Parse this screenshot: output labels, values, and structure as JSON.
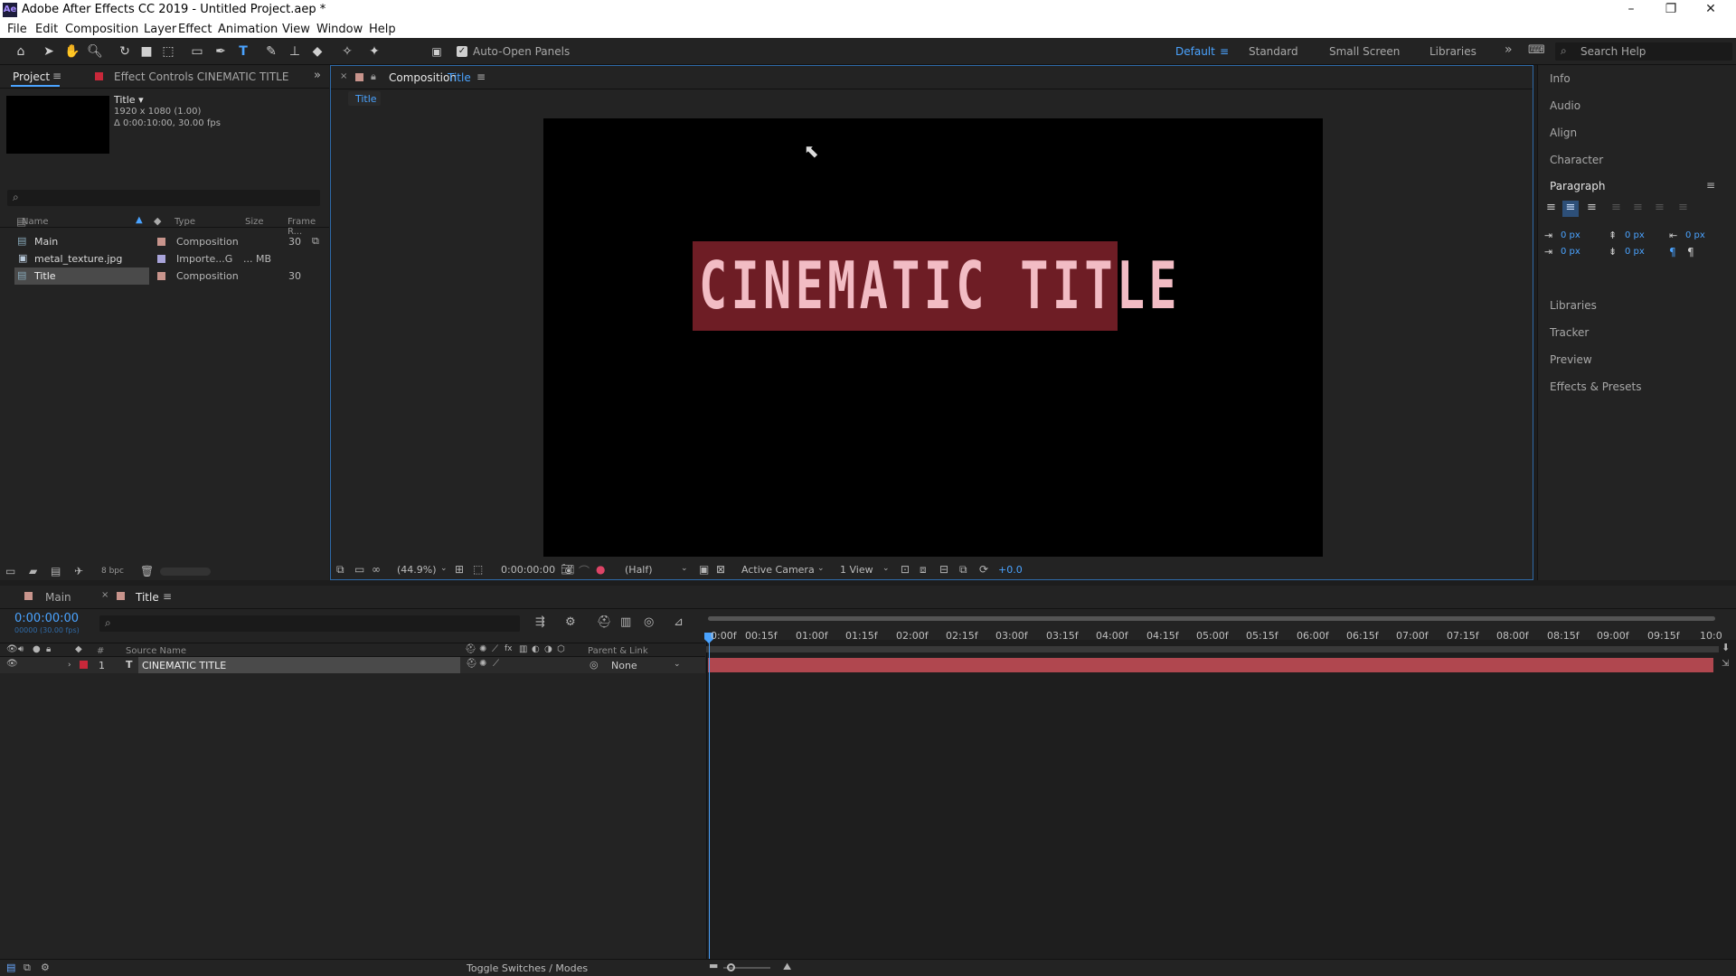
{
  "window": {
    "title": "Adobe After Effects CC 2019 - Untitled Project.aep *",
    "app_icon": "Ae",
    "minimize": "–",
    "restore": "❐",
    "close": "✕"
  },
  "menu": [
    "File",
    "Edit",
    "Composition",
    "Layer",
    "Effect",
    "Animation",
    "View",
    "Window",
    "Help"
  ],
  "toolbar": {
    "auto_open_panels": "Auto-Open Panels",
    "workspaces": [
      "Default",
      "Standard",
      "Small Screen",
      "Libraries"
    ],
    "overflow": "»",
    "search_help": "Search Help"
  },
  "project_panel": {
    "tab_project": "Project",
    "tab_effect_controls": "Effect Controls CINEMATIC TITLE",
    "selected_name": "Title ▾",
    "selected_dims": "1920 x 1080 (1.00)",
    "selected_duration": "Δ 0:00:10:00, 30.00 fps",
    "search_placeholder": "",
    "columns": [
      "Name",
      "Type",
      "Size",
      "Frame R..."
    ],
    "items": [
      {
        "name": "Main",
        "type": "Composition",
        "size": "",
        "frame_rate": "30"
      },
      {
        "name": "metal_texture.jpg",
        "type": "Importe...G",
        "size": "... MB",
        "frame_rate": ""
      },
      {
        "name": "Title",
        "type": "Composition",
        "size": "",
        "frame_rate": "30"
      }
    ],
    "bpc": "8 bpc"
  },
  "composition_panel": {
    "tab_label": "Composition",
    "comp_name": "Title",
    "flow_tab": "Title",
    "canvas_text": "CINEMATIC TITLE",
    "zoom": "(44.9%)",
    "timecode": "0:00:00:00",
    "resolution": "(Half)",
    "camera": "Active Camera",
    "views": "1 View",
    "exposure": "+0.0"
  },
  "right_panels": {
    "items": [
      "Info",
      "Audio",
      "Align",
      "Character",
      "Paragraph",
      "Libraries",
      "Tracker",
      "Preview",
      "Effects & Presets"
    ],
    "paragraph_values": [
      "0 px",
      "0 px",
      "0 px",
      "0 px",
      "0 px"
    ]
  },
  "timeline": {
    "tab_main": "Main",
    "tab_title": "Title",
    "timecode": "0:00:00:00",
    "frame_info": "00000 (30.00 fps)",
    "col_source_name": "Source Name",
    "col_parent": "Parent & Link",
    "layer_number": "1",
    "layer_name": "CINEMATIC TITLE",
    "layer_parent": "None",
    "ruler": [
      "0:00f",
      "00:15f",
      "01:00f",
      "01:15f",
      "02:00f",
      "02:15f",
      "03:00f",
      "03:15f",
      "04:00f",
      "04:15f",
      "05:00f",
      "05:15f",
      "06:00f",
      "06:15f",
      "07:00f",
      "07:15f",
      "08:00f",
      "08:15f",
      "09:00f",
      "09:15f",
      "10:0"
    ],
    "toggle_label": "Toggle Switches / Modes"
  },
  "colors": {
    "accent": "#4aa3ff",
    "layer_label": "#c8283a",
    "layer_bar": "#b0474f",
    "title_box": "#6e1d25",
    "title_text": "#f2bcc4"
  }
}
